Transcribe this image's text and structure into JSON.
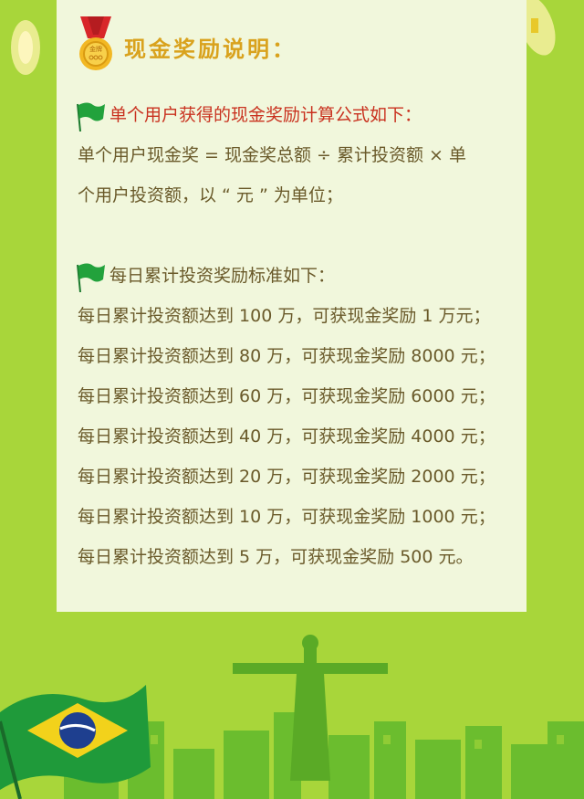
{
  "title": "现金奖励说明：",
  "medal_text": "金牌",
  "section1": {
    "heading": "单个用户获得的现金奖励计算公式如下：",
    "lines": [
      "单个用户现金奖 = 现金奖总额 ÷ 累计投资额 × 单",
      "个用户投资额，以 “ 元 ” 为单位；"
    ]
  },
  "section2": {
    "heading": "每日累计投资奖励标准如下：",
    "lines": [
      "每日累计投资额达到 100 万，可获现金奖励 1 万元；",
      "每日累计投资额达到 80 万，可获现金奖励 8000 元；",
      "每日累计投资额达到 60 万，可获现金奖励 6000 元；",
      "每日累计投资额达到 40 万，可获现金奖励 4000 元；",
      "每日累计投资额达到 20 万，可获现金奖励 2000 元；",
      "每日累计投资额达到 10 万，可获现金奖励 1000 元；",
      "每日累计投资额达到 5 万，可获现金奖励 500 元。"
    ]
  },
  "colors": {
    "background": "#a8d63a",
    "card": "#f1f7dc",
    "title": "#d9a21d",
    "heading_red": "#c9321f",
    "body_text": "#6a5a2a",
    "flag_green": "#1f9a3a"
  }
}
